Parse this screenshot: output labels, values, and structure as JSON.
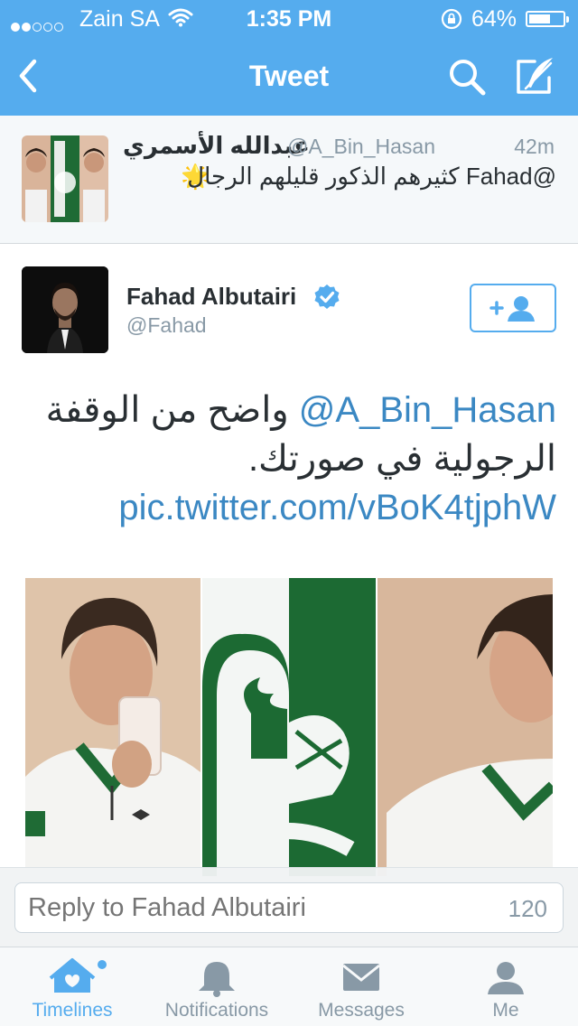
{
  "status_bar": {
    "carrier": "Zain SA",
    "time": "1:35 PM",
    "battery_percent": "64%",
    "battery_level": 0.64,
    "signal_bars": 2
  },
  "nav": {
    "title": "Tweet",
    "icons": [
      "back-chevron-icon",
      "search-icon",
      "compose-tweet-icon"
    ]
  },
  "parent_tweet": {
    "name": "عبدالله الأسمري",
    "handle": "@A_Bin_Hasan",
    "time": "42m",
    "text": "@Fahad كثيرهم الذكور قليلهم الرجال",
    "emoji": "🌟"
  },
  "main_tweet": {
    "name": "Fahad Albutairi",
    "handle": "@Fahad",
    "verified": true,
    "text_mention": "@A_Bin_Hasan",
    "text_body": "واضح من الوقفة الرجولية في صورتك.",
    "text_link": "pic.twitter.com/vBoK4tjphW"
  },
  "reply": {
    "placeholder": "Reply to Fahad Albutairi",
    "char_count": "120"
  },
  "tabs": [
    {
      "label": "Timelines",
      "icon": "home-icon",
      "active": true
    },
    {
      "label": "Notifications",
      "icon": "bell-icon",
      "active": false
    },
    {
      "label": "Messages",
      "icon": "envelope-icon",
      "active": false
    },
    {
      "label": "Me",
      "icon": "person-icon",
      "active": false
    }
  ],
  "colors": {
    "accent": "#55acee",
    "link": "#3b88c3",
    "text": "#292f33",
    "secondary_text": "#8899a6"
  }
}
